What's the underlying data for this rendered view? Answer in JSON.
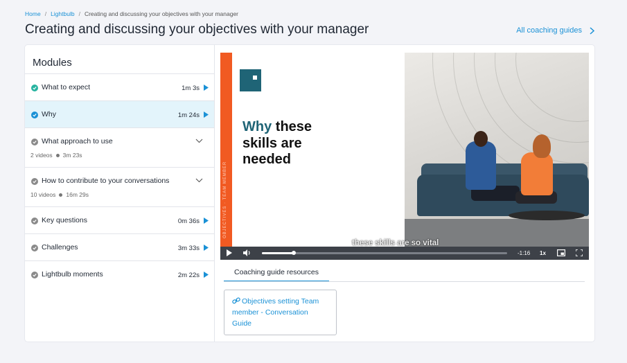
{
  "breadcrumb": {
    "home": "Home",
    "sep1": "/",
    "lightbulb": "Lightbulb",
    "sep2": "/",
    "current": "Creating and discussing your objectives with your manager"
  },
  "page": {
    "title": "Creating and discussing your objectives with your manager",
    "all_guides": "All coaching guides"
  },
  "modules": {
    "title": "Modules",
    "items": [
      {
        "label": "What to expect",
        "duration": "1m 3s",
        "status": "completed"
      },
      {
        "label": "Why",
        "duration": "1m 24s",
        "status": "active"
      },
      {
        "label": "What approach to use",
        "videos": "2 videos",
        "total": "3m 23s",
        "status": "group"
      },
      {
        "label": "How to contribute to your conversations",
        "videos": "10 videos",
        "total": "16m 29s",
        "status": "group"
      },
      {
        "label": "Key questions",
        "duration": "0m 36s",
        "status": "pending"
      },
      {
        "label": "Challenges",
        "duration": "3m 33s",
        "status": "pending"
      },
      {
        "label": "Lightbulb moments",
        "duration": "2m 22s",
        "status": "pending"
      }
    ]
  },
  "video": {
    "slide_title_accent": "Why",
    "slide_title_rest1": "these",
    "slide_title_line2": "skills are",
    "slide_title_line3": "needed",
    "vertical_text": "OBJECTIVES · TEAM MEMBER",
    "subtitle": "these skills are so vital",
    "time_remaining": "-1:16",
    "speed": "1x",
    "progress": 0.13
  },
  "resources": {
    "tab_label": "Coaching guide resources",
    "link_text": "Objectives setting Team member - Conversation Guide"
  },
  "colors": {
    "accent": "#1a91d6",
    "completed": "#27b3a0",
    "pending": "#8a8a8a",
    "active_bg": "#e3f4fb",
    "orange": "#f15a22",
    "teal": "#1f6476"
  },
  "icons": [
    "chevron-right-icon",
    "check-icon",
    "play-icon",
    "chevron-down-icon",
    "volume-icon",
    "picture-in-picture-icon",
    "fullscreen-icon",
    "link-icon"
  ]
}
